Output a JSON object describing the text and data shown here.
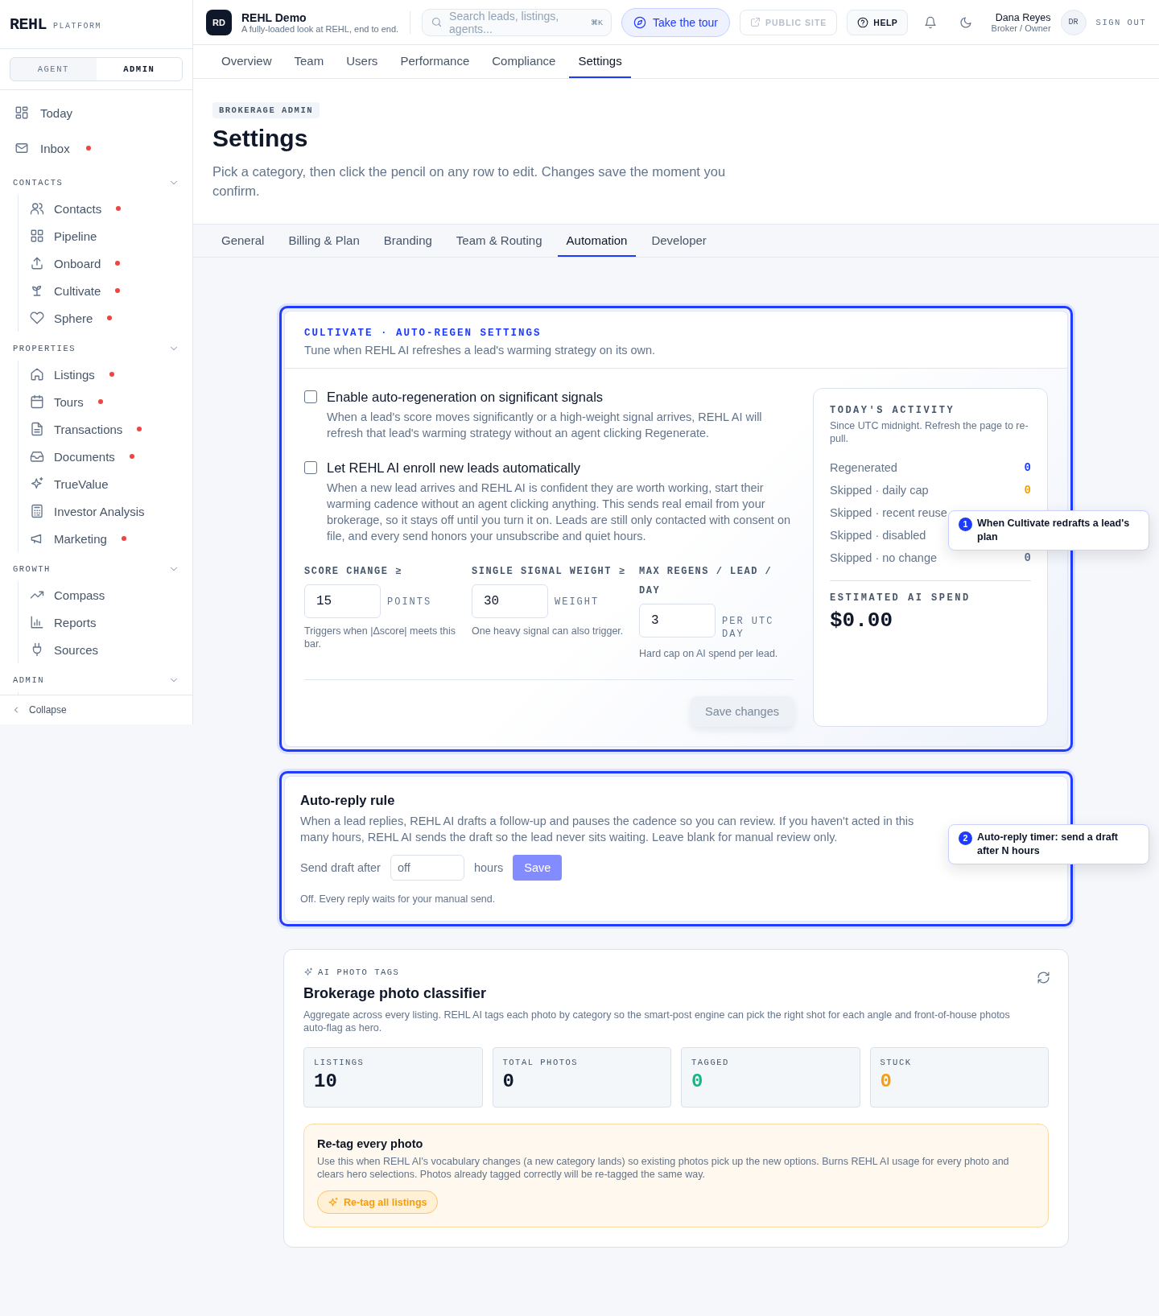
{
  "brand": {
    "name": "REHL",
    "tag": "PLATFORM"
  },
  "sidebar": {
    "modes": [
      {
        "label": "AGENT",
        "selected": false
      },
      {
        "label": "ADMIN",
        "selected": true
      }
    ],
    "top_items": [
      {
        "label": "Today",
        "dot": false
      },
      {
        "label": "Inbox",
        "dot": true
      }
    ],
    "groups": [
      {
        "title": "CONTACTS",
        "expanded": true,
        "items": [
          {
            "label": "Contacts",
            "dot": true
          },
          {
            "label": "Pipeline",
            "dot": false
          },
          {
            "label": "Onboard",
            "dot": true
          },
          {
            "label": "Cultivate",
            "dot": true
          },
          {
            "label": "Sphere",
            "dot": true
          }
        ]
      },
      {
        "title": "PROPERTIES",
        "expanded": true,
        "items": [
          {
            "label": "Listings",
            "dot": true
          },
          {
            "label": "Tours",
            "dot": true
          },
          {
            "label": "Transactions",
            "dot": true
          },
          {
            "label": "Documents",
            "dot": true
          },
          {
            "label": "TrueValue",
            "dot": false
          },
          {
            "label": "Investor Analysis",
            "dot": false
          },
          {
            "label": "Marketing",
            "dot": true
          }
        ]
      },
      {
        "title": "GROWTH",
        "expanded": true,
        "items": [
          {
            "label": "Compass",
            "dot": false
          },
          {
            "label": "Reports",
            "dot": false
          },
          {
            "label": "Sources",
            "dot": false
          }
        ]
      },
      {
        "title": "ADMIN",
        "expanded": true
      }
    ],
    "collapse": "Collapse"
  },
  "topbar": {
    "avatar": "RD",
    "workspace": "REHL Demo",
    "subtitle": "A fully-loaded look at REHL, end to end.",
    "search": {
      "placeholder": "Search leads, listings, agents...",
      "shortcut": "⌘K"
    },
    "tour": "Take the tour",
    "public_site": {
      "label": "PUBLIC SITE",
      "disabled": true
    },
    "help": "HELP",
    "user": {
      "name": "Dana Reyes",
      "role": "Broker / Owner",
      "initials": "DR"
    },
    "sign_out": "SIGN OUT"
  },
  "nav_tabs": [
    {
      "label": "Overview",
      "selected": false
    },
    {
      "label": "Team",
      "selected": false
    },
    {
      "label": "Users",
      "selected": false
    },
    {
      "label": "Performance",
      "selected": false
    },
    {
      "label": "Compliance",
      "selected": false
    },
    {
      "label": "Settings",
      "selected": true
    }
  ],
  "header": {
    "eyebrow": "BROKERAGE ADMIN",
    "title": "Settings",
    "description": "Pick a category, then click the pencil on any row to edit. Changes save the moment you confirm."
  },
  "settings_tabs": [
    {
      "label": "General",
      "selected": false
    },
    {
      "label": "Billing & Plan",
      "selected": false
    },
    {
      "label": "Branding",
      "selected": false
    },
    {
      "label": "Team & Routing",
      "selected": false
    },
    {
      "label": "Automation",
      "selected": true
    },
    {
      "label": "Developer",
      "selected": false
    }
  ],
  "regen_card": {
    "eyebrow": "CULTIVATE · AUTO-REGEN SETTINGS",
    "subtitle": "Tune when REHL AI refreshes a lead's warming strategy on its own.",
    "options": [
      {
        "label": "Enable auto-regeneration on significant signals",
        "description": "When a lead's score moves significantly or a high-weight signal arrives, REHL AI will refresh that lead's warming strategy without an agent clicking Regenerate.",
        "checked": false
      },
      {
        "label": "Let REHL AI enroll new leads automatically",
        "description": "When a new lead arrives and REHL AI is confident they are worth working, start their warming cadence without an agent clicking anything. This sends real email from your brokerage, so it stays off until you turn it on. Leads are still only contacted with consent on file, and every send honors your unsubscribe and quiet hours.",
        "checked": false
      }
    ],
    "thresholds": [
      {
        "label": "SCORE CHANGE ≥",
        "value": "15",
        "unit": "POINTS",
        "help": "Triggers when |Δscore| meets this bar."
      },
      {
        "label": "SINGLE SIGNAL WEIGHT ≥",
        "value": "30",
        "unit": "WEIGHT",
        "help": "One heavy signal can also trigger."
      },
      {
        "label": "MAX REGENS / LEAD / DAY",
        "value": "3",
        "unit": "PER UTC DAY",
        "help": "Hard cap on AI spend per lead."
      }
    ],
    "save": {
      "label": "Save changes",
      "disabled": true
    },
    "activity": {
      "title": "TODAY'S ACTIVITY",
      "note": "Since UTC midnight. Refresh the page to re-pull.",
      "rows": [
        {
          "label": "Regenerated",
          "value": "0",
          "color": "#1d3bff"
        },
        {
          "label": "Skipped · daily cap",
          "value": "0",
          "color": "#f59e0b"
        },
        {
          "label": "Skipped · recent reuse"
        },
        {
          "label": "Skipped · disabled"
        },
        {
          "label": "Skipped · no change",
          "value": "0",
          "color": "#64748b"
        }
      ],
      "spend_label": "ESTIMATED AI SPEND",
      "spend": "$0.00"
    }
  },
  "auto_reply": {
    "title": "Auto-reply rule",
    "description": "When a lead replies, REHL AI drafts a follow-up and pauses the cadence so you can review. If you haven't acted in this many hours, REHL AI sends the draft so the lead never sits waiting. Leave blank for manual review only.",
    "field_label": "Send draft after",
    "placeholder": "off",
    "unit": "hours",
    "save": "Save",
    "note": "Off. Every reply waits for your manual send."
  },
  "photo_card": {
    "eyebrow": "AI PHOTO TAGS",
    "title": "Brokerage photo classifier",
    "description": "Aggregate across every listing. REHL AI tags each photo by category so the smart-post engine can pick the right shot for each angle and front-of-house photos auto-flag as hero.",
    "stats": [
      {
        "label": "LISTINGS",
        "value": "10",
        "color": "#0f172a"
      },
      {
        "label": "TOTAL PHOTOS",
        "value": "0",
        "color": "#0f172a"
      },
      {
        "label": "TAGGED",
        "value": "0",
        "color": "#10b981"
      },
      {
        "label": "STUCK",
        "value": "0",
        "color": "#f59e0b"
      }
    ],
    "retag": {
      "title": "Re-tag every photo",
      "description": "Use this when REHL AI's vocabulary changes (a new category lands) so existing photos pick up the new options. Burns REHL AI usage for every photo and clears hero selections. Photos already tagged correctly will be re-tagged the same way.",
      "button": "Re-tag all listings"
    }
  },
  "tour_tips": [
    {
      "number": "1",
      "text": "When Cultivate redrafts a lead's plan"
    },
    {
      "number": "2",
      "text": "Auto-reply timer: send a draft after N hours"
    }
  ]
}
